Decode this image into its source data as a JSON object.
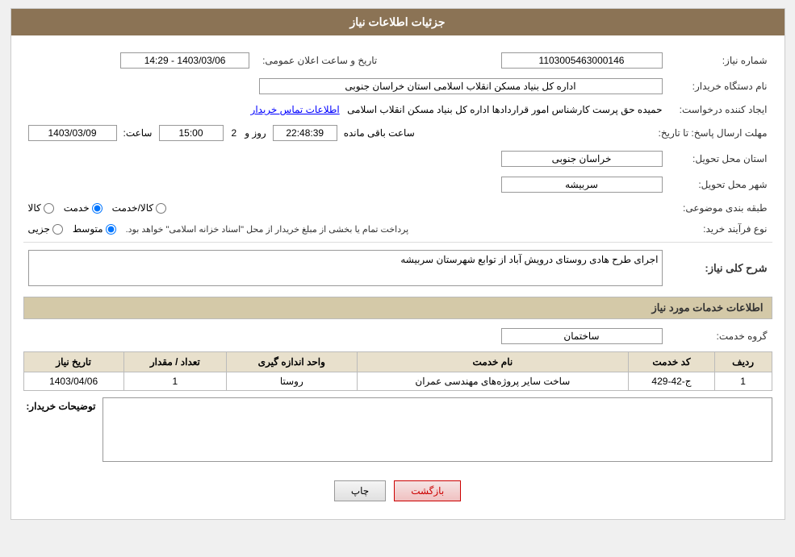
{
  "page": {
    "title": "جزئیات اطلاعات نیاز"
  },
  "header": {
    "announcement_number_label": "شماره نیاز:",
    "announcement_number_value": "1103005463000146",
    "datetime_label": "تاریخ و ساعت اعلان عمومی:",
    "datetime_value": "1403/03/06 - 14:29",
    "buyer_org_label": "نام دستگاه خریدار:",
    "buyer_org_value": "اداره کل بنیاد مسکن انقلاب اسلامی استان خراسان جنوبی",
    "creator_label": "ایجاد کننده درخواست:",
    "creator_value": "حمیده حق پرست کارشناس امور قراردادها اداره کل بنیاد مسکن انقلاب اسلامی",
    "creator_link": "اطلاعات تماس خریدار",
    "deadline_label": "مهلت ارسال پاسخ: تا تاریخ:",
    "deadline_date": "1403/03/09",
    "deadline_time_label": "ساعت:",
    "deadline_time": "15:00",
    "deadline_days_label": "روز و",
    "deadline_days": "2",
    "deadline_remaining_label": "ساعت باقی مانده",
    "deadline_remaining": "22:48:39",
    "province_label": "استان محل تحویل:",
    "province_value": "خراسان جنوبی",
    "city_label": "شهر محل تحویل:",
    "city_value": "سربیشه",
    "category_label": "طبقه بندی موضوعی:",
    "category_options": [
      "کالا",
      "خدمت",
      "کالا/خدمت"
    ],
    "category_selected": "خدمت",
    "purchase_type_label": "نوع فرآیند خرید:",
    "purchase_options": [
      "جزیی",
      "متوسط"
    ],
    "purchase_selected": "متوسط",
    "purchase_note": "پرداخت تمام یا بخشی از مبلغ خریدار از محل \"اسناد خزانه اسلامی\" خواهد بود."
  },
  "need_description": {
    "section_label": "شرح کلی نیاز:",
    "value": "اجرای طرح هادی روستای  درویش آباد از توابع شهرستان سربیشه"
  },
  "services_section": {
    "title": "اطلاعات خدمات مورد نیاز",
    "service_group_label": "گروه خدمت:",
    "service_group_value": "ساختمان",
    "table_headers": [
      "ردیف",
      "کد خدمت",
      "نام خدمت",
      "واحد اندازه گیری",
      "تعداد / مقدار",
      "تاریخ نیاز"
    ],
    "table_rows": [
      {
        "row": "1",
        "code": "ج-42-429",
        "name": "ساخت سایر پروژه‌های مهندسی عمران",
        "unit": "روستا",
        "quantity": "1",
        "date": "1403/04/06"
      }
    ]
  },
  "buyer_notes": {
    "label": "توضیحات خریدار:",
    "value": ""
  },
  "buttons": {
    "print": "چاپ",
    "back": "بازگشت"
  }
}
